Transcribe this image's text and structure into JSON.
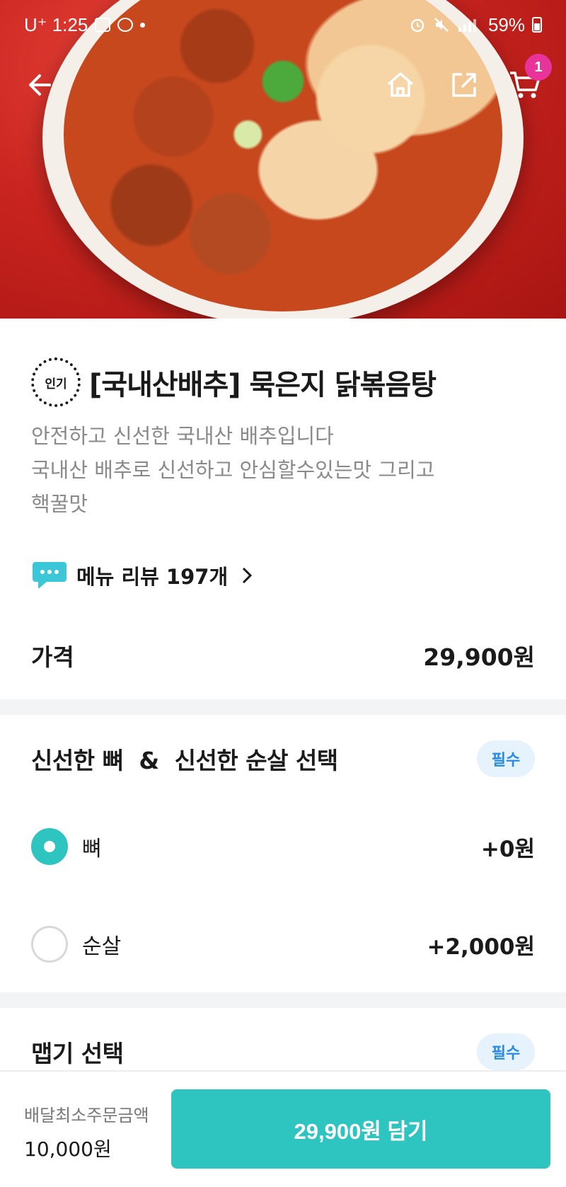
{
  "status_bar": {
    "carrier_time": "U⁺ 1:25",
    "battery": "59%"
  },
  "nav": {
    "cart_count": "1"
  },
  "menu": {
    "badge": "인기",
    "title": "[국내산배추] 묵은지 닭볶음탕",
    "description_lines": [
      "안전하고 신선한 국내산 배추입니다",
      "국내산 배추로 신선하고 안심할수있는맛 그리고",
      "핵꿀맛"
    ],
    "review_label": "메뉴 리뷰 197개",
    "price_label": "가격",
    "price_value": "29,900원"
  },
  "sections": [
    {
      "title": "신선한 뼈  &  신선한 순살 선택",
      "badge": "필수",
      "options": [
        {
          "label": "뼈",
          "price": "+0원",
          "selected": true
        },
        {
          "label": "순살",
          "price": "+2,000원",
          "selected": false
        }
      ]
    },
    {
      "title": "맵기 선택",
      "badge": "필수"
    }
  ],
  "bottom_bar": {
    "min_order_label": "배달최소주문금액",
    "min_order_value": "10,000원",
    "add_button": "29,900원 담기"
  },
  "colors": {
    "accent": "#2ec4bf",
    "badge_pink": "#e8349a",
    "required_text": "#2a8be3"
  }
}
